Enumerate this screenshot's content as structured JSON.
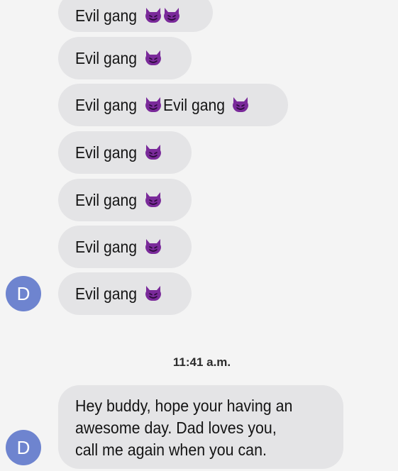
{
  "messages": [
    {
      "text": "Evil gang",
      "emojis": [
        "purple-devil",
        "purple-devil"
      ]
    },
    {
      "text": "Evil gang",
      "emojis": [
        "purple-devil"
      ]
    },
    {
      "text": "Evil gang",
      "emojis": [
        "purple-devil"
      ],
      "text2": "Evil gang",
      "emojis2": [
        "purple-devil"
      ]
    },
    {
      "text": "Evil gang",
      "emojis": [
        "purple-devil"
      ]
    },
    {
      "text": "Evil gang",
      "emojis": [
        "purple-devil"
      ]
    },
    {
      "text": "Evil gang",
      "emojis": [
        "purple-devil"
      ]
    },
    {
      "text": "Evil gang",
      "emojis": [
        "purple-devil"
      ]
    }
  ],
  "avatar": {
    "initial": "D",
    "color": "#6e84cf"
  },
  "timestamp": "11:41 a.m.",
  "last_message": {
    "lines": [
      "Hey buddy, hope your having an",
      "awesome day. Dad loves you,",
      "call me again when you can."
    ]
  },
  "colors": {
    "bubble": "#e4e4e6",
    "background": "#f4f4f4",
    "emoji": "#7a2a9a"
  }
}
